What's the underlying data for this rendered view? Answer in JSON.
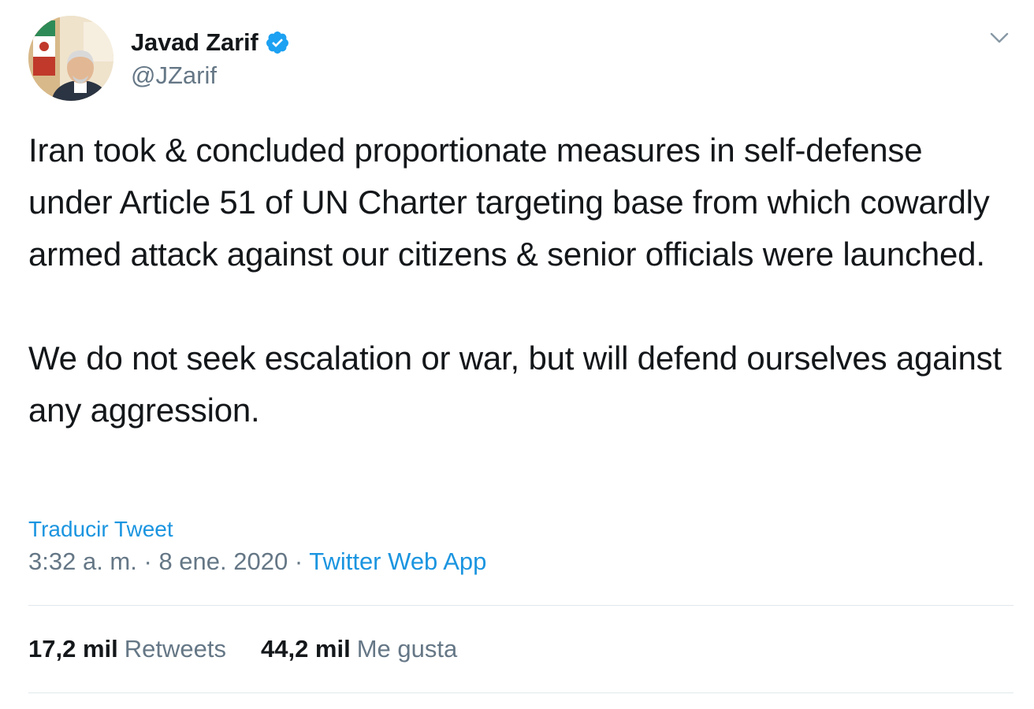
{
  "author": {
    "display_name": "Javad Zarif",
    "handle": "@JZarif",
    "verified": true
  },
  "tweet": {
    "paragraphs": [
      "Iran took & concluded proportionate measures in self-defense under Article 51 of UN Charter targeting base from which cowardly armed attack against our citizens & senior officials were launched.",
      "We do not seek escalation or war, but will defend ourselves against any aggression."
    ],
    "translate_label": "Traducir Tweet",
    "time": "3:32 a. m.",
    "date": "8 ene. 2020",
    "separator": "·",
    "source": "Twitter Web App"
  },
  "stats": {
    "retweets_count": "17,2 mil",
    "retweets_label": "Retweets",
    "likes_count": "44,2 mil",
    "likes_label": "Me gusta"
  },
  "icons": {
    "verified": "verified-badge-icon",
    "caret": "chevron-down-icon"
  },
  "colors": {
    "text": "#14171a",
    "secondary": "#657786",
    "link": "#1b95e0",
    "divider": "#e1e8ed",
    "verified": "#1da1f2"
  }
}
